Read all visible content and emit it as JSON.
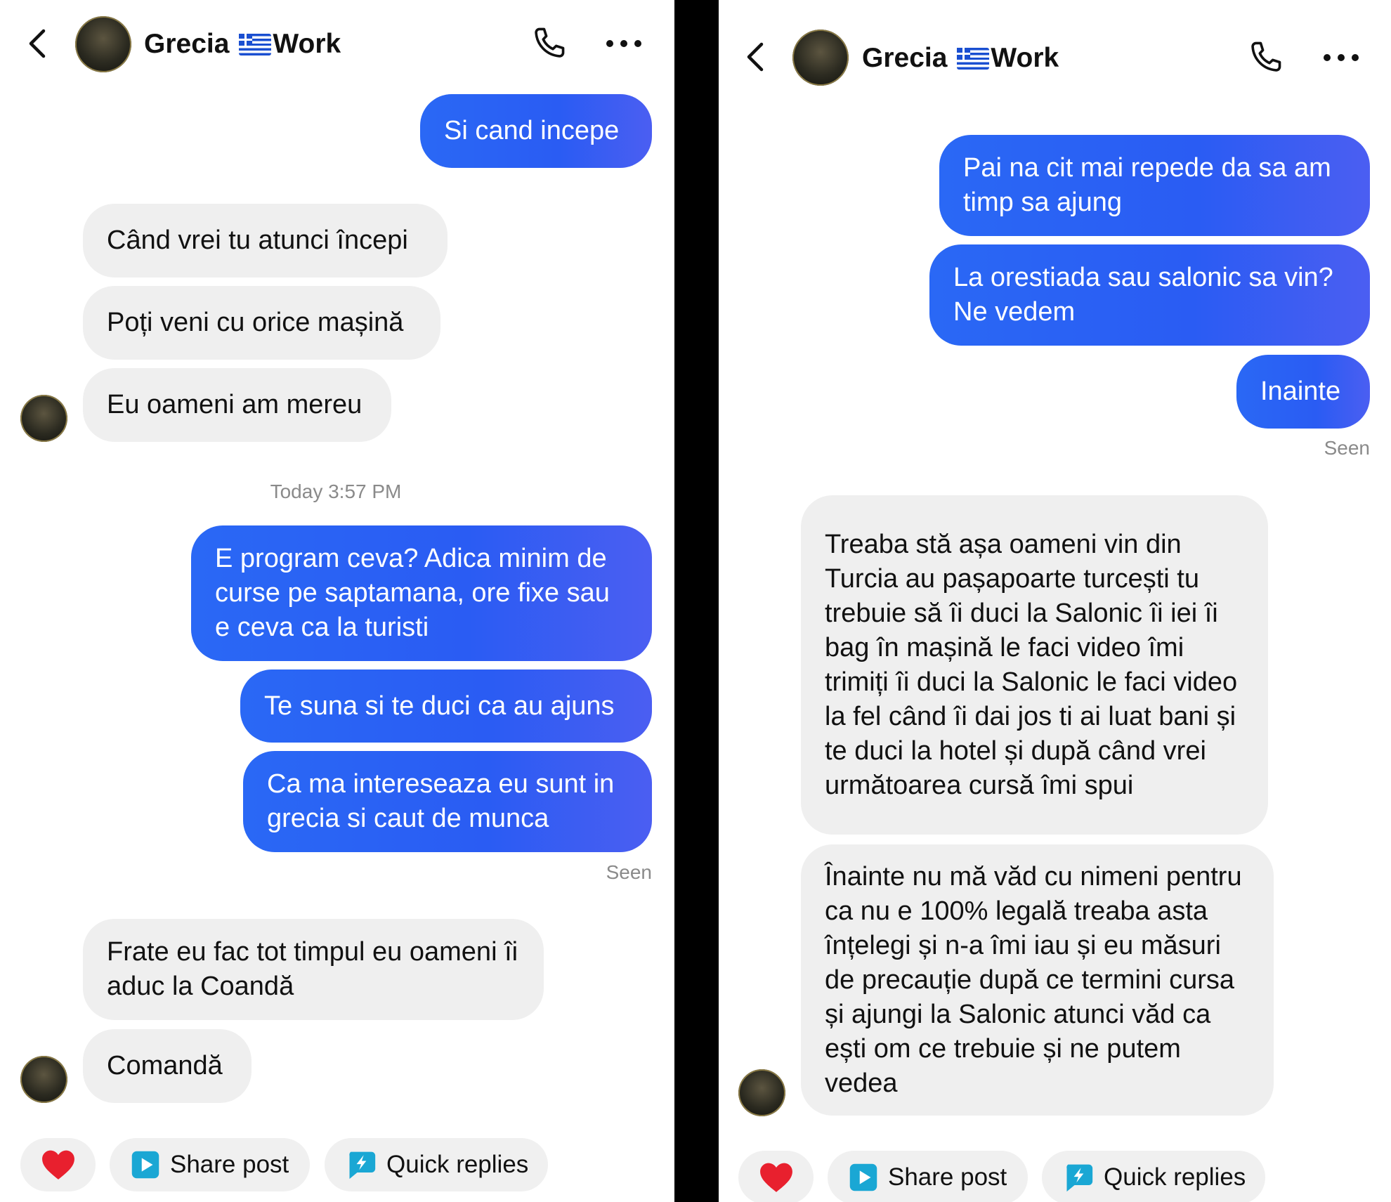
{
  "colors": {
    "accent": "#2a62f4",
    "incoming_bubble": "#efefef",
    "heart": "#e8202e",
    "chip_icon": "#1aa7d4"
  },
  "left": {
    "header": {
      "title": "Grecia 🇬🇷Work",
      "title_text_a": "Grecia",
      "title_text_b": "Work"
    },
    "messages": [
      {
        "dir": "out",
        "text": "Si cand incepe"
      },
      {
        "dir": "in",
        "text": "Când vrei tu atunci începi"
      },
      {
        "dir": "in",
        "text": "Poți veni cu orice mașină"
      },
      {
        "dir": "in",
        "text": "Eu oameni am mereu"
      },
      {
        "dir": "out",
        "text": "E program ceva? Adica minim de curse pe saptamana, ore fixe sau e ceva ca la turisti"
      },
      {
        "dir": "out",
        "text": "Te suna si te duci ca au ajuns"
      },
      {
        "dir": "out",
        "text": "Ca ma intereseaza eu sunt in grecia si caut de munca"
      },
      {
        "dir": "in",
        "text": "Frate eu fac tot timpul eu oameni îi aduc la Coandă"
      },
      {
        "dir": "in",
        "text": "Comandă"
      }
    ],
    "timestamp": "Today 3:57 PM",
    "seen": "Seen",
    "chips": {
      "share": "Share post",
      "quick": "Quick replies"
    }
  },
  "right": {
    "header": {
      "title_text_a": "Grecia",
      "title_text_b": "Work"
    },
    "messages": [
      {
        "dir": "out",
        "text": "Pai na cit mai repede da sa am timp sa ajung"
      },
      {
        "dir": "out",
        "text": "La orestiada sau salonic sa vin? Ne vedem"
      },
      {
        "dir": "out",
        "text": "Inainte"
      },
      {
        "dir": "in",
        "text": "Treaba stă așa oameni vin din Turcia au pașapoarte turcești tu trebuie să îi duci la Salonic îi iei îi bag în mașină le faci video îmi trimiți îi duci la Salonic le faci video la fel când îi dai jos ti ai luat bani și te duci la hotel și după când vrei următoarea cursă îmi spui"
      },
      {
        "dir": "in",
        "text": "Înainte nu mă văd cu nimeni pentru ca nu e 100% legală treaba asta înțelegi și n-a îmi iau și eu măsuri de precauție după ce termini cursa și ajungi la Salonic atunci văd ca ești om ce trebuie și ne putem vedea"
      }
    ],
    "seen": "Seen",
    "chips": {
      "share": "Share post",
      "quick": "Quick replies"
    }
  }
}
